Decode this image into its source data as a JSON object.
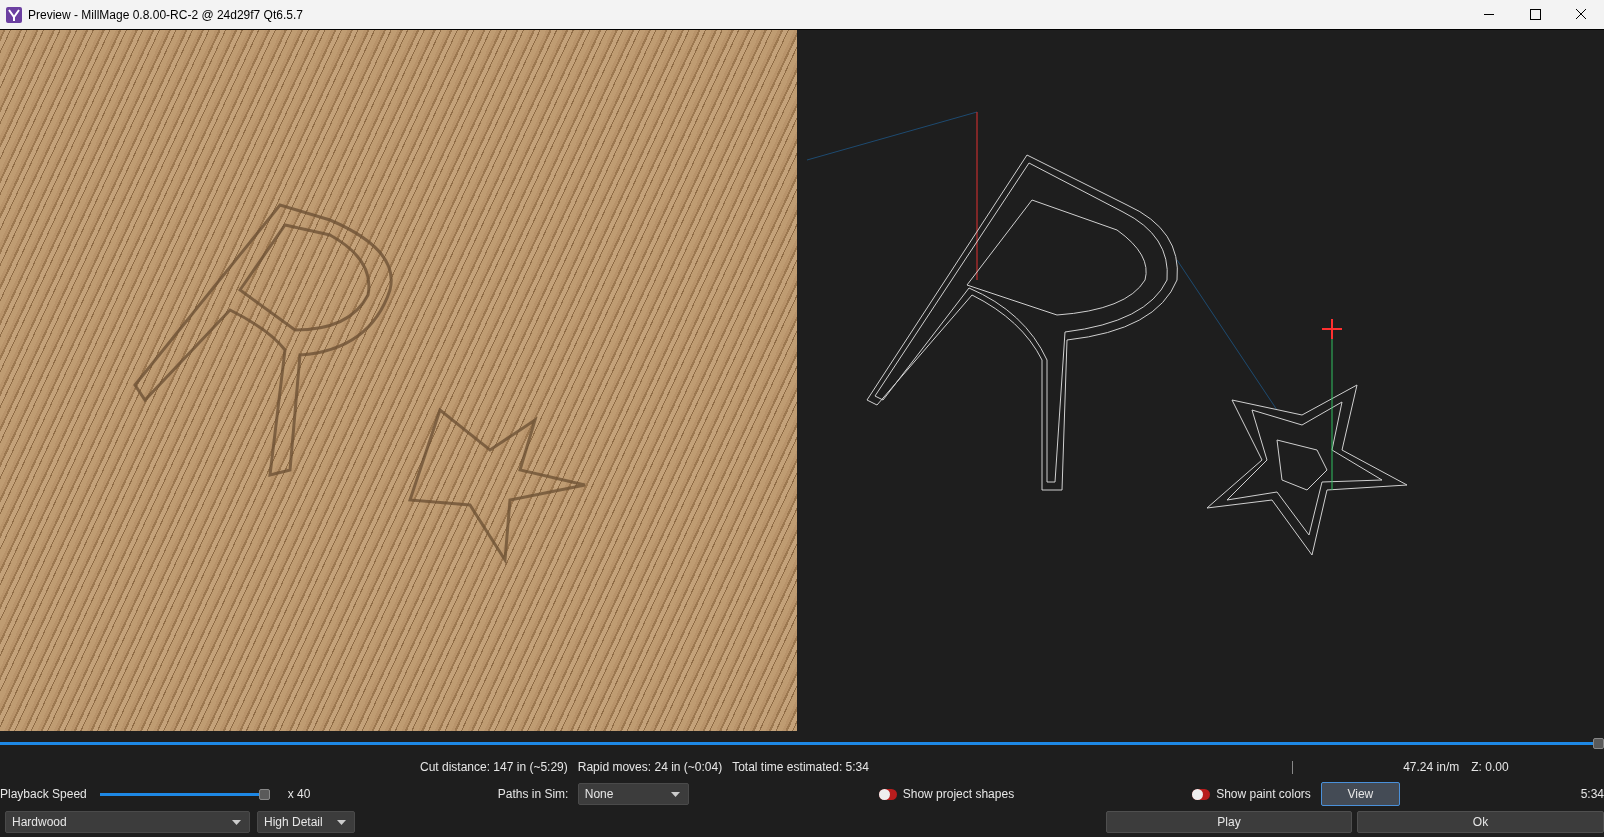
{
  "window": {
    "title": "Preview - MillMage 0.8.00-RC-2 @ 24d29f7 Qt6.5.7"
  },
  "timeline": {
    "level": 1
  },
  "stats": {
    "cut_distance": "Cut distance: 147 in (~5:29)",
    "rapid_moves": "Rapid moves: 24 in (~0:04)",
    "total_time": "Total time estimated: 5:34",
    "feed_rate": "47.24 in/m",
    "z_position": "Z: 0.00"
  },
  "playback_speed": {
    "label": "Playback Speed",
    "level": 1,
    "reading": "x 40"
  },
  "paths_in_sim": {
    "label": "Paths in Sim:",
    "value": "None"
  },
  "toggles": [
    {
      "label": "Show project shapes",
      "on": false
    },
    {
      "label": "Show paint colors",
      "on": false
    }
  ],
  "view_button": "View",
  "elapsed": "5:34",
  "material": "Hardwood",
  "detail": "High Detail",
  "buttons": [
    "Play",
    "Ok"
  ]
}
